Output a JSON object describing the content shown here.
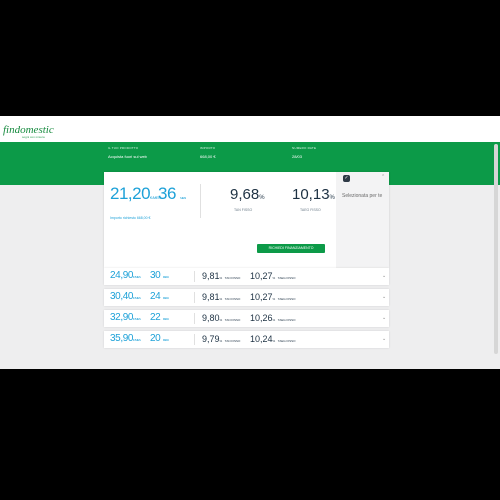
{
  "brand": {
    "logo": "findomestic",
    "tagline": "sogni con misura",
    "green": "#0c9a48",
    "blue": "#1da1d8"
  },
  "summary": [
    {
      "label": "IL TUO PRODOTTO",
      "value": "Acquista fuori sul web"
    },
    {
      "label": "IMPORTO",
      "value": "668,00 €"
    },
    {
      "label": "NUMERO RATE",
      "value": "28/03"
    }
  ],
  "selected": {
    "rata": "21,20",
    "rata_unit": "€ /MES",
    "mesi": "36",
    "mesi_unit": "MESI",
    "tan": "9,68",
    "tan_label": "TAN FISSO",
    "taeg": "10,13",
    "taeg_label": "TAEG FISSO",
    "percent": "%",
    "importo_link": "Importo richiesto 668,00 €",
    "button": "RICHIEDI FINANZIAMENTO",
    "selection_text": "Selezionata per te",
    "check_icon": "check-icon"
  },
  "options": [
    {
      "rata": "24,90",
      "rata_unit": "€ /MES",
      "mesi": "30",
      "mesi_unit": "MESI",
      "tan": "9,81",
      "tan_label": "TAN FISSO",
      "taeg": "10,27",
      "taeg_label": "TAEG FISSO"
    },
    {
      "rata": "30,40",
      "rata_unit": "€ /MES",
      "mesi": "24",
      "mesi_unit": "MESI",
      "tan": "9,81",
      "tan_label": "TAN FISSO",
      "taeg": "10,27",
      "taeg_label": "TAEG FISSO"
    },
    {
      "rata": "32,90",
      "rata_unit": "€ /MES",
      "mesi": "22",
      "mesi_unit": "MESI",
      "tan": "9,80",
      "tan_label": "TAN FISSO",
      "taeg": "10,26",
      "taeg_label": "TAEG FISSO"
    },
    {
      "rata": "35,90",
      "rata_unit": "€ /MES",
      "mesi": "20",
      "mesi_unit": "MESI",
      "tan": "9,79",
      "tan_label": "TAN FISSO",
      "taeg": "10,24",
      "taeg_label": "TAEG FISSO"
    }
  ]
}
